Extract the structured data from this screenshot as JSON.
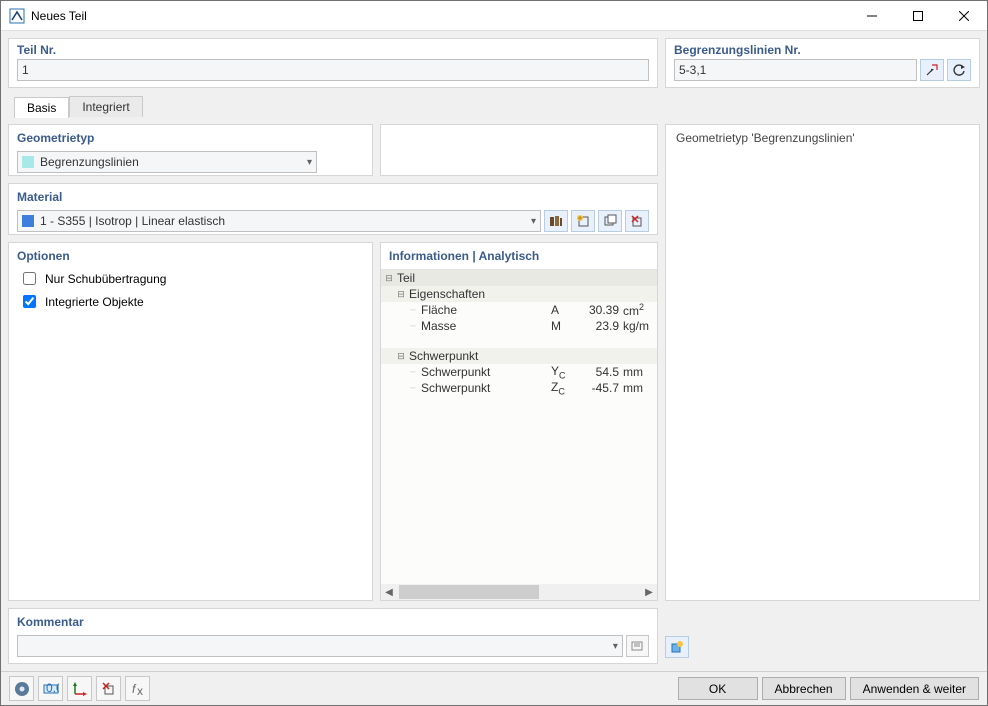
{
  "window": {
    "title": "Neues Teil"
  },
  "teil_nr": {
    "label": "Teil Nr.",
    "value": "1"
  },
  "begrenzung": {
    "label": "Begrenzungslinien Nr.",
    "value": "5-3,1"
  },
  "tabs": {
    "basis": "Basis",
    "integriert": "Integriert"
  },
  "geom": {
    "label": "Geometrietyp",
    "value": "Begrenzungslinien"
  },
  "material": {
    "label": "Material",
    "value": "1 - S355 | Isotrop | Linear elastisch"
  },
  "options": {
    "label": "Optionen",
    "schub": "Nur Schubübertragung",
    "integrierte": "Integrierte Objekte"
  },
  "info": {
    "label": "Informationen | Analytisch",
    "teil": "Teil",
    "eigenschaften": "Eigenschaften",
    "flaeche": {
      "label": "Fläche",
      "sym": "A",
      "val": "30.39",
      "unit_base": "cm",
      "unit_sup": "2"
    },
    "masse": {
      "label": "Masse",
      "sym": "M",
      "val": "23.9",
      "unit": "kg/m"
    },
    "schwerpunkt_hdr": "Schwerpunkt",
    "sp_y": {
      "label": "Schwerpunkt",
      "sym": "Y",
      "sub": "C",
      "val": "54.5",
      "unit": "mm"
    },
    "sp_z": {
      "label": "Schwerpunkt",
      "sym": "Z",
      "sub": "C",
      "val": "-45.7",
      "unit": "mm"
    }
  },
  "preview": {
    "text": "Geometrietyp 'Begrenzungslinien'"
  },
  "kommentar": {
    "label": "Kommentar",
    "value": ""
  },
  "buttons": {
    "ok": "OK",
    "cancel": "Abbrechen",
    "apply": "Anwenden & weiter"
  }
}
